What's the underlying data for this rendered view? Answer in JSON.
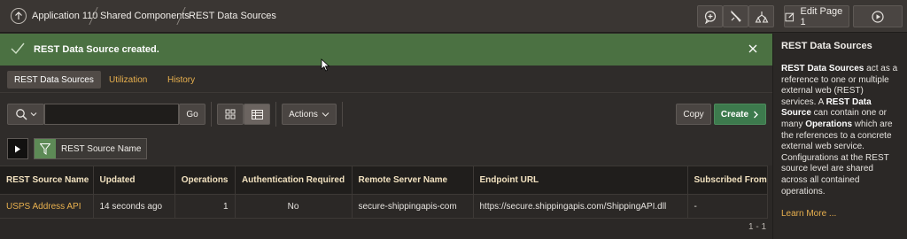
{
  "breadcrumb": {
    "items": [
      "Application 110",
      "Shared Components",
      "REST Data Sources"
    ]
  },
  "toolbar_top": {
    "edit_page_label": "Edit Page 1",
    "icons": [
      "create-icon",
      "edit-utilities-icon",
      "team-development-icon",
      "run-page-icon"
    ]
  },
  "alert": {
    "message": "REST Data Source created."
  },
  "help": {
    "title": "REST Data Sources",
    "p1_b1": "REST Data Sources",
    "p1_t1": " act as a reference to one or multiple external web (REST) services. A ",
    "p1_b2": "REST Data Source",
    "p1_t2": " can contain one or many ",
    "p1_b3": "Operations",
    "p1_t3": " which are the references to a concrete external web service. Configurations at the REST source level are shared across all contained operations.",
    "learn_more": "Learn More ..."
  },
  "tabs": [
    {
      "label": "REST Data Sources",
      "active": true
    },
    {
      "label": "Utilization",
      "active": false
    },
    {
      "label": "History",
      "active": false
    }
  ],
  "search": {
    "value": "",
    "go_label": "Go"
  },
  "actions": {
    "actions_label": "Actions",
    "copy_label": "Copy",
    "create_label": "Create"
  },
  "facet": {
    "filter_label": "REST Source Name"
  },
  "table": {
    "columns": [
      "REST Source Name",
      "Updated",
      "Operations",
      "Authentication Required",
      "Remote Server Name",
      "Endpoint URL",
      "Subscribed From"
    ],
    "rows": [
      [
        "USPS Address API",
        "14 seconds ago",
        "1",
        "No",
        "secure-shippingapis-com",
        "https://secure.shippingapis.com/ShippingAPI.dll",
        "-"
      ]
    ],
    "pagination": "1 - 1"
  },
  "colors": {
    "accent": "#e8b04e",
    "success": "#4b7142",
    "create": "#3d7a4d"
  }
}
